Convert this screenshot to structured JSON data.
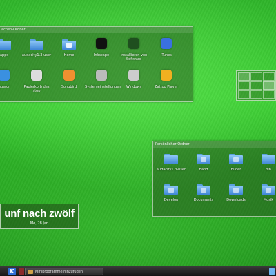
{
  "desktop_folder": {
    "title": "ächen-Ordner",
    "items": [
      {
        "label": "apps",
        "icon": "folder-icon",
        "emblem": "#3a6fc0"
      },
      {
        "label": "audacity1.3-user",
        "icon": "folder-icon",
        "emblem": "#3a6fc0"
      },
      {
        "label": "Home",
        "icon": "home-folder-icon",
        "emblem": "#e9f4ff"
      },
      {
        "label": "Inkscape",
        "icon": "inkscape-icon",
        "emblem": "#111111"
      },
      {
        "label": "Installieren von Software",
        "icon": "software-install-icon",
        "emblem": "#1f4f1f"
      },
      {
        "label": "iTunes",
        "icon": "itunes-icon",
        "emblem": "#3a70e0"
      },
      {
        "label": "queror",
        "icon": "konqueror-icon",
        "emblem": "#3a90e0"
      },
      {
        "label": "Papierkorb des stop",
        "icon": "trash-icon",
        "emblem": "#dddddd"
      },
      {
        "label": "Songbird",
        "icon": "songbird-icon",
        "emblem": "#f09030"
      },
      {
        "label": "Systemeinstellungen",
        "icon": "system-settings-icon",
        "emblem": "#bbbbbb"
      },
      {
        "label": "Windows",
        "icon": "drive-icon",
        "emblem": "#cccccc"
      },
      {
        "label": "Zattoo Player",
        "icon": "zattoo-tv-icon",
        "emblem": "#f0b020"
      }
    ]
  },
  "personal_folder": {
    "title": "Persönlicher Ordner",
    "items": [
      {
        "label": "audacity1.3-user",
        "icon": "folder-icon"
      },
      {
        "label": "Band",
        "icon": "music-folder-icon"
      },
      {
        "label": "Bilder",
        "icon": "pictures-folder-icon"
      },
      {
        "label": "bin",
        "icon": "folder-icon"
      },
      {
        "label": "Develop",
        "icon": "develop-folder-icon"
      },
      {
        "label": "Documents",
        "icon": "documents-folder-icon"
      },
      {
        "label": "Downloads",
        "icon": "downloads-folder-icon"
      },
      {
        "label": "Musik",
        "icon": "music-folder-icon"
      }
    ]
  },
  "clock": {
    "time": "unf nach zwölf",
    "date": "Mo, 28 Jan"
  },
  "panel": {
    "kmenu_glyph": "K",
    "task_label": "Miniprogramme hinzufügen"
  },
  "colors": {
    "wallpaper_green": "#3ccf33",
    "folder_blue": "#5aa0e0",
    "panel_dark": "#1e1e1e"
  }
}
